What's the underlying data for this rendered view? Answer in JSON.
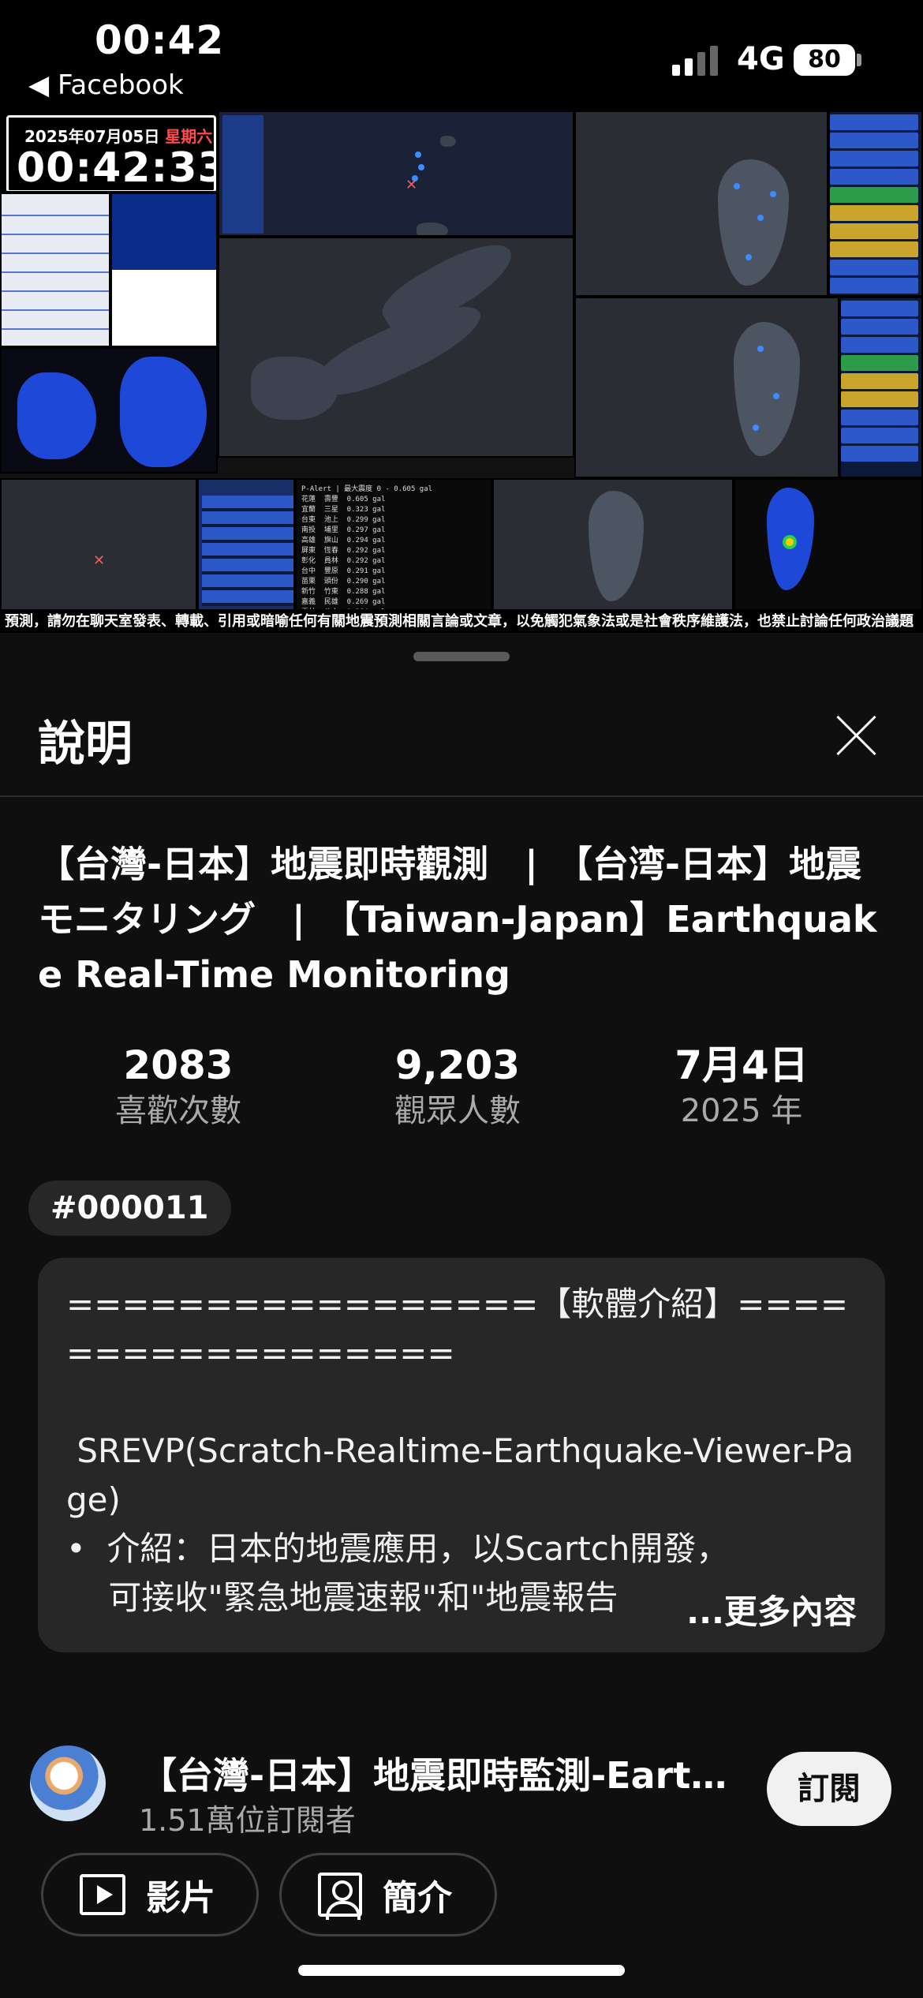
{
  "status_bar": {
    "time": "00:42",
    "back_app": "Facebook",
    "network": "4G",
    "battery": "80"
  },
  "video": {
    "clock_date": "2025年07月05日",
    "clock_weekday": "星期六",
    "clock_time": "00:42:33",
    "ticker": "預測，請勿在聊天室發表、轉載、引用或暗喻任何有關地震預測相關言論或文章，以免觸犯氣象法或是社會秩序維護法，也禁止討論任何政治議題"
  },
  "sheet": {
    "title": "說明",
    "video_title": "【台灣-日本】地震即時觀測　|　【台湾-日本】地震モニタリング　|　【Taiwan-Japan】Earthquake Real-Time Monitoring",
    "stats": [
      {
        "value": "2083",
        "label": "喜歡次數"
      },
      {
        "value": "9,203",
        "label": "觀眾人數"
      },
      {
        "value": "7月4日",
        "label": "2025 年"
      }
    ],
    "hashtag": "#000011",
    "description": "=================【軟體介紹】==================\n\n SREVP(Scratch-Realtime-Earthquake-Viewer-Page)\n•  介紹：日本的地震應用，以Scartch開發，\n    可接收\"緊急地震速報\"和\"地震報告",
    "more_label": "...更多內容"
  },
  "channel": {
    "name": "【台灣-日本】地震即時監測-Earthquake Real-Time Monitoring",
    "subscribers": "1.51萬位訂閱者",
    "subscribe_label": "訂閱"
  },
  "buttons": {
    "videos_label": "影片",
    "about_label": "簡介"
  }
}
